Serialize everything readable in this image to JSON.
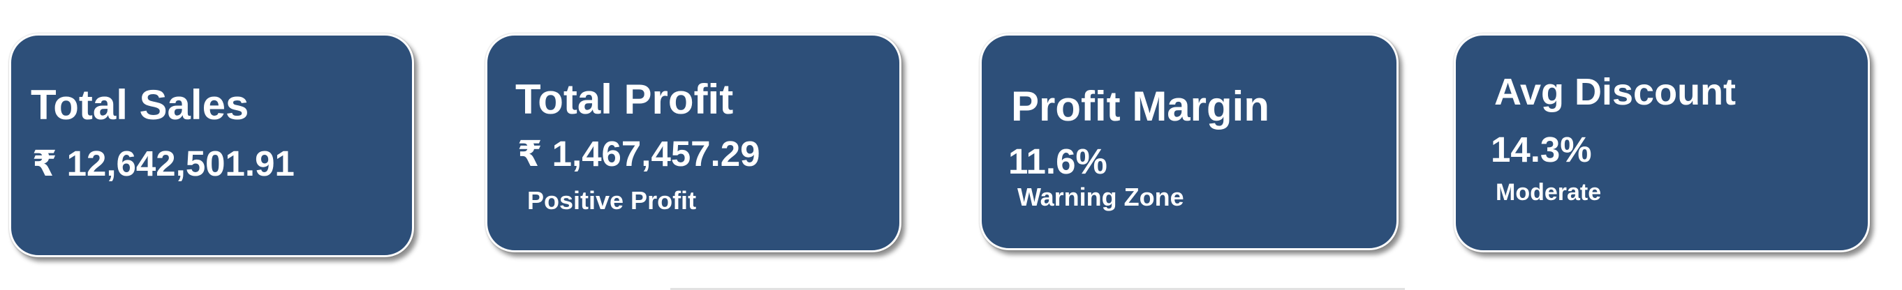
{
  "cards": {
    "total_sales": {
      "title": "Total Sales",
      "value": "₹ 12,642,501.91"
    },
    "total_profit": {
      "title": "Total Profit",
      "value": "₹ 1,467,457.29",
      "status": "Positive Profit"
    },
    "profit_margin": {
      "title": "Profit Margin",
      "value": "11.6%",
      "status": "Warning Zone"
    },
    "avg_discount": {
      "title": "Avg Discount",
      "value": "14.3%",
      "status": "Moderate"
    }
  },
  "colors": {
    "card_background": "#2d4f79",
    "card_text": "#ffffff",
    "page_background": "#ffffff"
  }
}
